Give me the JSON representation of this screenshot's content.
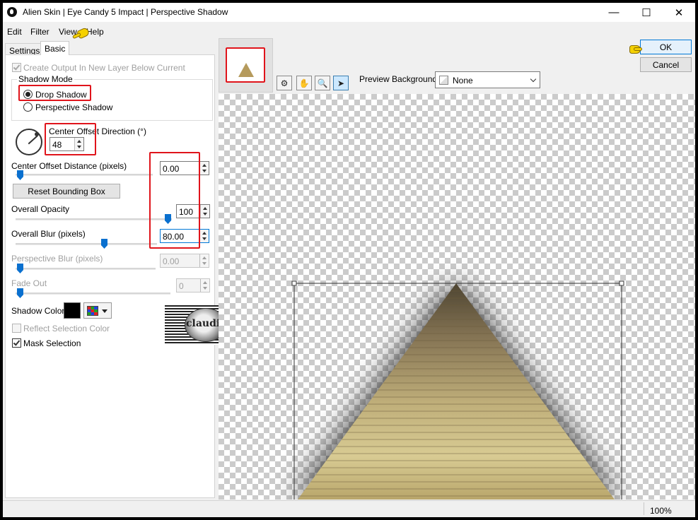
{
  "window": {
    "title": "Alien Skin | Eye Candy 5 Impact | Perspective Shadow"
  },
  "titlebar": {
    "minimize": "—",
    "maximize": "☐",
    "close": "✕"
  },
  "menu": {
    "items": [
      "Edit",
      "Filter",
      "View",
      "Help"
    ]
  },
  "tabs": [
    "Settings",
    "Basic"
  ],
  "basic": {
    "create_output_label": "Create Output In New Layer Below Current",
    "create_output_checked": true,
    "shadow_mode": {
      "title": "Shadow Mode",
      "options": [
        "Drop Shadow",
        "Perspective Shadow"
      ],
      "selected": "Drop Shadow"
    },
    "center_offset_direction": {
      "label": "Center Offset Direction (°)",
      "value": "48"
    },
    "center_offset_distance": {
      "label": "Center Offset Distance (pixels)",
      "value": "0.00",
      "fraction": 0.0
    },
    "reset_bounding_box": "Reset Bounding Box",
    "overall_opacity": {
      "label": "Overall Opacity",
      "value": "100",
      "fraction": 1.0
    },
    "overall_blur": {
      "label": "Overall Blur (pixels)",
      "value": "80.00",
      "fraction": 0.64
    },
    "perspective_blur": {
      "label": "Perspective Blur (pixels)",
      "value": "0.00",
      "fraction": 0.0
    },
    "fade_out": {
      "label": "Fade Out",
      "value": "0",
      "fraction": 0.0
    },
    "shadow_color": {
      "label": "Shadow Color",
      "color": "#000000"
    },
    "reflect_selection_color": {
      "label": "Reflect Selection Color",
      "checked": false
    },
    "mask_selection": {
      "label": "Mask Selection",
      "checked": true
    }
  },
  "watermark": {
    "text": "claudia"
  },
  "preview": {
    "background_label": "Preview Background:",
    "background_value": "None"
  },
  "buttons": {
    "ok": "OK",
    "cancel": "Cancel"
  },
  "status": {
    "zoom": "100%"
  },
  "colors": {
    "highlight": "#e0141b",
    "accent": "#0a70cf",
    "pointer_hand": "#f5d100"
  }
}
